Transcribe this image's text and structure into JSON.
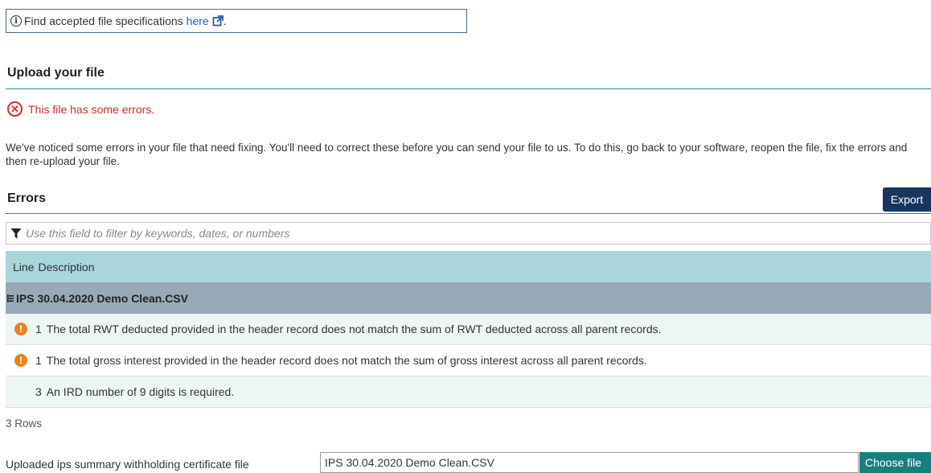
{
  "info": {
    "text": "Find accepted file specifications ",
    "link_text": "here",
    "suffix": "."
  },
  "upload": {
    "title": "Upload your file",
    "status": "This file has some errors.",
    "notice": "We've noticed some errors in your file that need fixing. You'll need to correct these before you can send your file to us. To do this, go back to your software, reopen the file, fix the errors and then re-upload your file."
  },
  "errors": {
    "title": "Errors",
    "export_label": "Export",
    "filter_placeholder": "Use this field to filter by keywords, dates, or numbers",
    "columns": {
      "line": "Line",
      "description": "Description"
    },
    "group": "IPS 30.04.2020 Demo Clean.CSV",
    "rows": [
      {
        "line": "1",
        "description": "The total RWT deducted provided in the header record does not match the sum of RWT deducted across all parent records.",
        "icon": "warning-icon"
      },
      {
        "line": "1",
        "description": "The total gross interest provided in the header record does not match the sum of gross interest across all parent records.",
        "icon": "warning-icon"
      },
      {
        "line": "3",
        "description": "An IRD number of 9 digits is required.",
        "icon": ""
      }
    ],
    "row_count": "3 Rows"
  },
  "file": {
    "label": "Uploaded ips summary withholding certificate file",
    "value": "IPS 30.04.2020 Demo Clean.CSV",
    "choose_label": "Choose file"
  },
  "colors": {
    "accent_teal": "#17807f",
    "error_red": "#d42a2a",
    "warning_orange": "#e8821e",
    "export_navy": "#16365c",
    "header_blue": "#a9d6db",
    "group_gray": "#9aa9b8"
  }
}
